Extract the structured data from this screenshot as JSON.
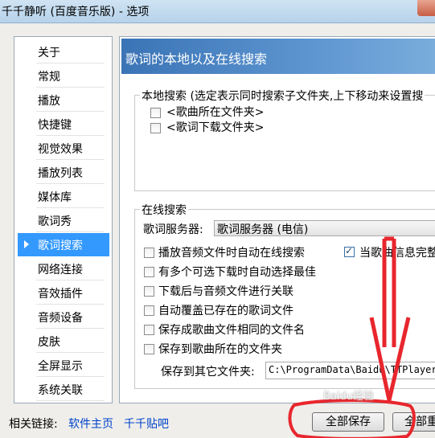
{
  "window": {
    "title": "千千静听 (百度音乐版) - 选项"
  },
  "sidebar": {
    "items": [
      {
        "label": "关于"
      },
      {
        "label": "常规"
      },
      {
        "label": "播放"
      },
      {
        "label": "快捷键"
      },
      {
        "label": "视觉效果"
      },
      {
        "label": "播放列表"
      },
      {
        "label": "媒体库"
      },
      {
        "label": "歌词秀"
      },
      {
        "label": "歌词搜索",
        "selected": true
      },
      {
        "label": "网络连接"
      },
      {
        "label": "音效插件"
      },
      {
        "label": "音频设备"
      },
      {
        "label": "皮肤"
      },
      {
        "label": "全屏显示"
      },
      {
        "label": "系统关联"
      }
    ]
  },
  "panel": {
    "header": "歌词的本地以及在线搜索",
    "local_search": {
      "title": "本地搜索 (选定表示同时搜索子文件夹,上下移动来设置搜",
      "items": [
        {
          "label": "<歌曲所在文件夹>",
          "checked": false
        },
        {
          "label": "<歌词下载文件夹>",
          "checked": false
        }
      ]
    },
    "online_search": {
      "title": "在线搜索",
      "server_label": "歌词服务器:",
      "server_value": "歌词服务器 (电信)",
      "options": [
        {
          "label": "播放音频文件时自动在线搜索",
          "checked": false
        },
        {
          "label": "有多个可选下载时自动选择最佳",
          "checked": false
        },
        {
          "label": "下载后与音频文件进行关联",
          "checked": false
        },
        {
          "label": "自动覆盖已存在的歌词文件",
          "checked": false
        },
        {
          "label": "保存成歌曲文件相同的文件名",
          "checked": false
        },
        {
          "label": "保存到歌曲所在的文件夹",
          "checked": false
        }
      ],
      "right_option": {
        "label": "当歌曲信息完整",
        "checked": true
      },
      "save_path_label": "保存到其它文件夹:",
      "save_path_value": "C:\\ProgramData\\Baidu\\TTPlayer"
    }
  },
  "footer": {
    "links_label": "相关链接:",
    "links": [
      "软件主页",
      "千千贴吧"
    ],
    "save_all": "全部保存",
    "second_button": "全部重"
  },
  "watermark": "Baidu经验",
  "colors": {
    "selection": "#3399ff",
    "header": "#3b74b6",
    "link": "#0044cc",
    "annotation": "#e8262d"
  }
}
